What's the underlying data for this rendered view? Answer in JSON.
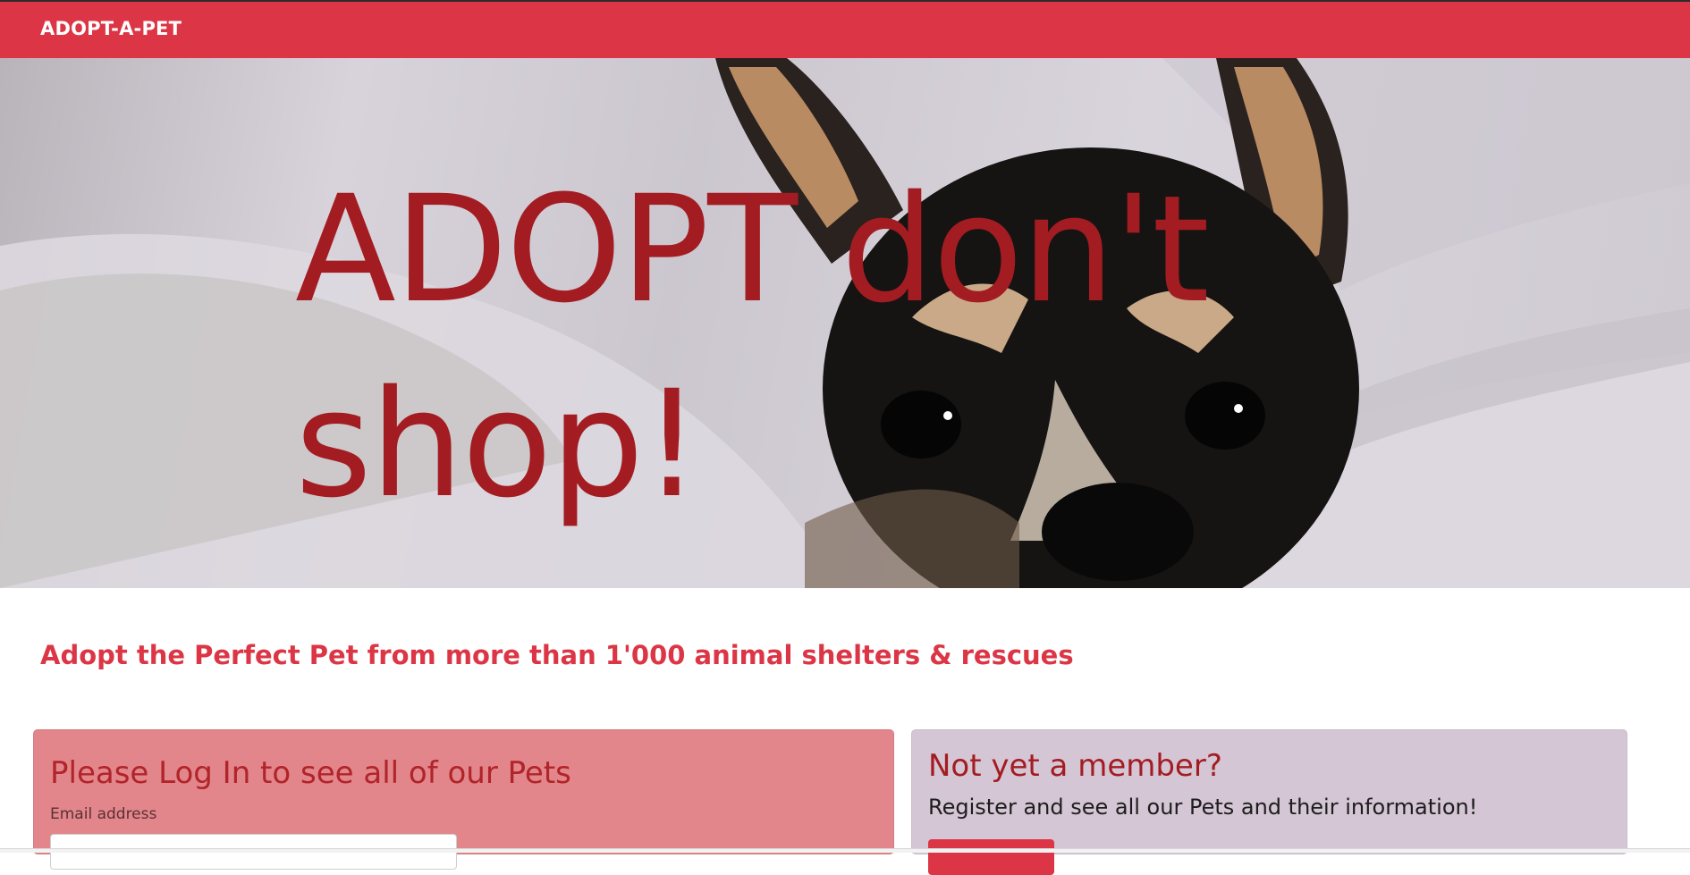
{
  "navbar": {
    "brand": "ADOPT-A-PET",
    "color": "#dc3545"
  },
  "hero": {
    "image": "dog-peeking-from-blanket",
    "title": "ADOPT don't shop!",
    "title_color": "#a31c22"
  },
  "tagline": "Adopt the Perfect Pet from more than 1'000 animal shelters & rescues",
  "login_card": {
    "heading": "Please Log In to see all of our Pets",
    "email_label": "Email address",
    "email_value": "",
    "background": "#e2868b"
  },
  "register_card": {
    "heading": "Not yet a member?",
    "text": "Register and see all our Pets and their information!",
    "button_label": "",
    "background": "#d4c6d4"
  }
}
